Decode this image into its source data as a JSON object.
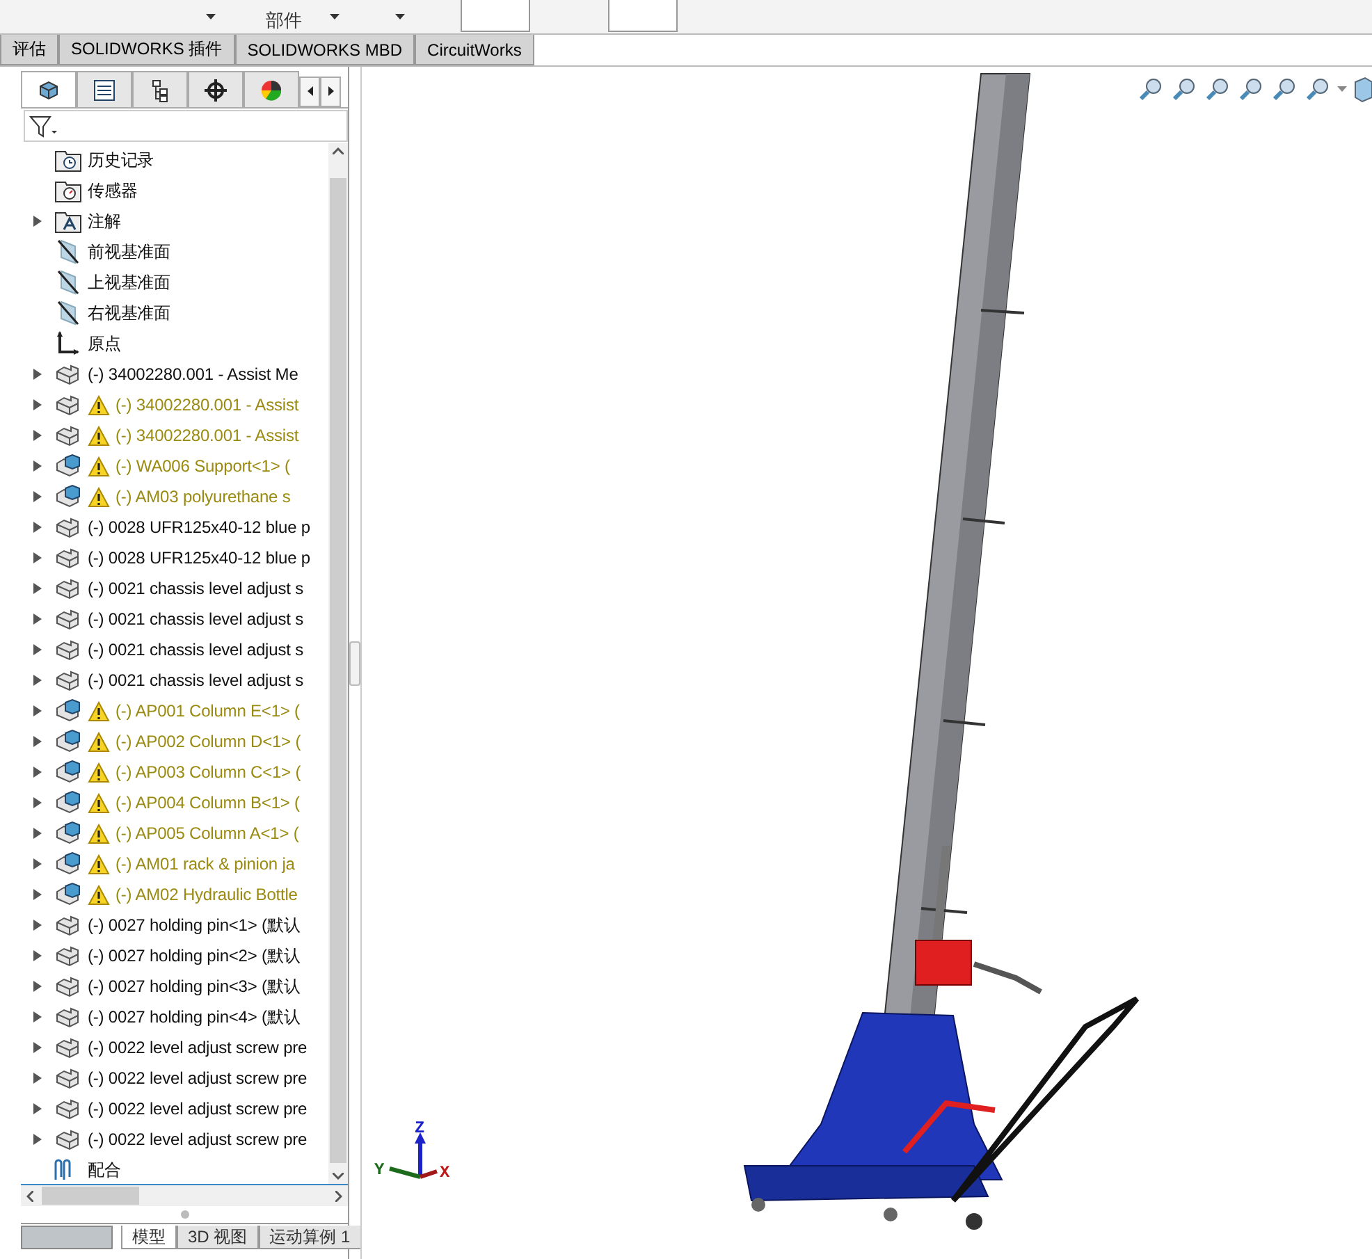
{
  "toolbar": {
    "partial_label": "部件"
  },
  "command_tabs": [
    {
      "label": "评估",
      "selected": false
    },
    {
      "label": "SOLIDWORKS 插件",
      "selected": false
    },
    {
      "label": "SOLIDWORKS MBD",
      "selected": false
    },
    {
      "label": "CircuitWorks",
      "selected": false
    }
  ],
  "panel_tabs": [
    {
      "kind": "feature",
      "selected": true
    },
    {
      "kind": "property",
      "selected": false
    },
    {
      "kind": "config",
      "selected": false
    },
    {
      "kind": "dimxpert",
      "selected": false
    },
    {
      "kind": "display",
      "selected": false
    }
  ],
  "tree": [
    {
      "kind": "history",
      "label": "历史记录",
      "expandable": false,
      "warning": false
    },
    {
      "kind": "sensor",
      "label": "传感器",
      "expandable": false,
      "warning": false
    },
    {
      "kind": "annotation",
      "label": "注解",
      "expandable": true,
      "warning": false
    },
    {
      "kind": "plane",
      "label": "前视基准面",
      "expandable": false,
      "warning": false
    },
    {
      "kind": "plane",
      "label": "上视基准面",
      "expandable": false,
      "warning": false
    },
    {
      "kind": "plane",
      "label": "右视基准面",
      "expandable": false,
      "warning": false
    },
    {
      "kind": "origin",
      "label": "原点",
      "expandable": false,
      "warning": false
    },
    {
      "kind": "part",
      "label": "(-) 34002280.001 - Assist Me",
      "expandable": true,
      "warning": false
    },
    {
      "kind": "part",
      "label": "(-) 34002280.001 - Assist",
      "expandable": true,
      "warning": true
    },
    {
      "kind": "part",
      "label": "(-) 34002280.001 - Assist",
      "expandable": true,
      "warning": true
    },
    {
      "kind": "assembly",
      "label": "(-) WA006 Support<1> (",
      "expandable": true,
      "warning": true
    },
    {
      "kind": "assembly",
      "label": "(-) AM03  polyurethane s",
      "expandable": true,
      "warning": true
    },
    {
      "kind": "part",
      "label": "(-) 0028 UFR125x40-12 blue p",
      "expandable": true,
      "warning": false
    },
    {
      "kind": "part",
      "label": "(-) 0028 UFR125x40-12 blue p",
      "expandable": true,
      "warning": false
    },
    {
      "kind": "part",
      "label": "(-) 0021 chassis level adjust s",
      "expandable": true,
      "warning": false
    },
    {
      "kind": "part",
      "label": "(-) 0021 chassis level adjust s",
      "expandable": true,
      "warning": false
    },
    {
      "kind": "part",
      "label": "(-) 0021 chassis level adjust s",
      "expandable": true,
      "warning": false
    },
    {
      "kind": "part",
      "label": "(-) 0021 chassis level adjust s",
      "expandable": true,
      "warning": false
    },
    {
      "kind": "assembly",
      "label": "(-) AP001 Column E<1> (",
      "expandable": true,
      "warning": true
    },
    {
      "kind": "assembly",
      "label": "(-) AP002 Column D<1> (",
      "expandable": true,
      "warning": true
    },
    {
      "kind": "assembly",
      "label": "(-) AP003 Column C<1> (",
      "expandable": true,
      "warning": true
    },
    {
      "kind": "assembly",
      "label": "(-) AP004 Column B<1> (",
      "expandable": true,
      "warning": true
    },
    {
      "kind": "assembly",
      "label": "(-) AP005 Column A<1> (",
      "expandable": true,
      "warning": true
    },
    {
      "kind": "assembly",
      "label": "(-) AM01 rack & pinion ja",
      "expandable": true,
      "warning": true
    },
    {
      "kind": "assembly",
      "label": "(-) AM02 Hydraulic Bottle",
      "expandable": true,
      "warning": true
    },
    {
      "kind": "part",
      "label": "(-) 0027 holding pin<1> (默认",
      "expandable": true,
      "warning": false
    },
    {
      "kind": "part",
      "label": "(-) 0027 holding pin<2> (默认",
      "expandable": true,
      "warning": false
    },
    {
      "kind": "part",
      "label": "(-) 0027 holding pin<3> (默认",
      "expandable": true,
      "warning": false
    },
    {
      "kind": "part",
      "label": "(-) 0027 holding pin<4> (默认",
      "expandable": true,
      "warning": false
    },
    {
      "kind": "part",
      "label": "(-) 0022 level adjust screw pre",
      "expandable": true,
      "warning": false
    },
    {
      "kind": "part",
      "label": "(-) 0022 level adjust screw pre",
      "expandable": true,
      "warning": false
    },
    {
      "kind": "part",
      "label": "(-) 0022 level adjust screw pre",
      "expandable": true,
      "warning": false
    },
    {
      "kind": "part",
      "label": "(-) 0022 level adjust screw pre",
      "expandable": true,
      "warning": false
    },
    {
      "kind": "mates",
      "label": "配合",
      "expandable": false,
      "warning": false
    }
  ],
  "bottom_tabs": [
    {
      "label": "模型",
      "selected": true
    },
    {
      "label": "3D 视图",
      "selected": false
    },
    {
      "label": "运动算例 1",
      "selected": false
    }
  ],
  "triad": {
    "x": "X",
    "y": "Y",
    "z": "Z"
  }
}
